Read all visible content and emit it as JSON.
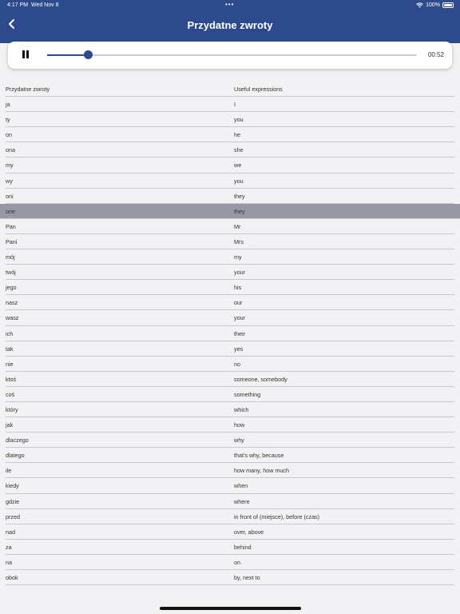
{
  "status": {
    "time": "4:17 PM",
    "date": "Wed Nov 8",
    "battery": "100%",
    "dots": "•••"
  },
  "nav": {
    "title": "Przydatne zwroty"
  },
  "player": {
    "duration": "00:52",
    "progress": 0.11
  },
  "colors": {
    "brand": "#2d4b8c",
    "highlight": "#9699a3"
  },
  "table": {
    "headers": [
      "Przydatne zwroty",
      "Useful expressions"
    ],
    "highlighted_index": 7,
    "rows": [
      [
        "ja",
        "I"
      ],
      [
        "ty",
        "you"
      ],
      [
        "on",
        "he"
      ],
      [
        "ona",
        "she"
      ],
      [
        "my",
        "we"
      ],
      [
        "wy",
        "you"
      ],
      [
        "oni",
        "they"
      ],
      [
        "one",
        "they"
      ],
      [
        "Pan",
        "Mr"
      ],
      [
        "Pani",
        "Mrs"
      ],
      [
        "mój",
        "my"
      ],
      [
        "twój",
        "your"
      ],
      [
        "jego",
        "his"
      ],
      [
        "nasz",
        "our"
      ],
      [
        "wasz",
        "your"
      ],
      [
        "ich",
        "their"
      ],
      [
        "tak",
        "yes"
      ],
      [
        "nie",
        "no"
      ],
      [
        "ktoś",
        "someone, somebody"
      ],
      [
        "coś",
        "something"
      ],
      [
        "który",
        "which"
      ],
      [
        "jak",
        "how"
      ],
      [
        "dlaczego",
        "why"
      ],
      [
        "dlatego",
        "that's why, because"
      ],
      [
        "ile",
        "how many, how much"
      ],
      [
        "kiedy",
        "when"
      ],
      [
        "gdzie",
        "where"
      ],
      [
        "przed",
        "in front of (miejsce), before (czas)"
      ],
      [
        "nad",
        "over, above"
      ],
      [
        "za",
        "behind"
      ],
      [
        "na",
        "on"
      ],
      [
        "obok",
        "by, next to"
      ]
    ]
  }
}
